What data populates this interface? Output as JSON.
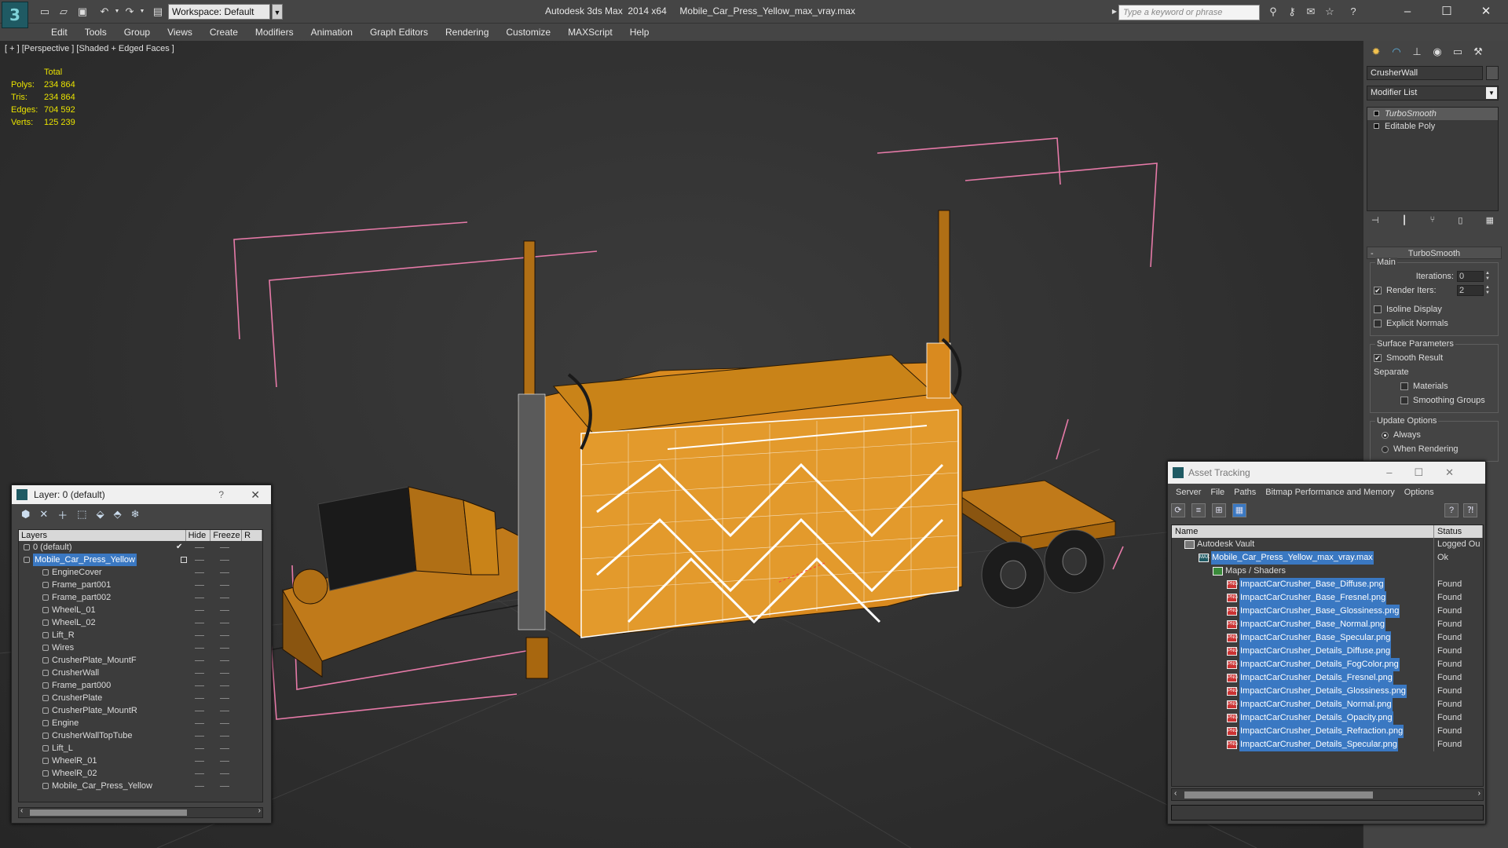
{
  "app": {
    "title": "Autodesk 3ds Max  2014 x64     Mobile_Car_Press_Yellow_max_vray.max",
    "workspace": "Workspace: Default",
    "search_placeholder": "Type a keyword or phrase"
  },
  "menu": [
    "Edit",
    "Tools",
    "Group",
    "Views",
    "Create",
    "Modifiers",
    "Animation",
    "Graph Editors",
    "Rendering",
    "Customize",
    "MAXScript",
    "Help"
  ],
  "viewport": {
    "label": "[ + ] [Perspective ] [Shaded + Edged Faces ]",
    "stats": {
      "header": "Total",
      "rows": [
        {
          "k": "Polys:",
          "v": "234 864"
        },
        {
          "k": "Tris:",
          "v": "234 864"
        },
        {
          "k": "Edges:",
          "v": "704 592"
        },
        {
          "k": "Verts:",
          "v": "125 239"
        }
      ]
    }
  },
  "command_panel": {
    "object_name": "CrusherWall",
    "modifier_list": "Modifier List",
    "stack": [
      "TurboSmooth",
      "Editable Poly"
    ],
    "rollout_title": "TurboSmooth",
    "main_group": "Main",
    "iterations_label": "Iterations:",
    "iterations_value": "0",
    "render_iters_label": "Render Iters:",
    "render_iters_value": "2",
    "isoline": "Isoline Display",
    "explicit": "Explicit Normals",
    "surface_group": "Surface Parameters",
    "smooth_result": "Smooth Result",
    "separate": "Separate",
    "materials": "Materials",
    "smoothing_groups": "Smoothing Groups",
    "update_group": "Update Options",
    "always": "Always",
    "when_rendering": "When Rendering"
  },
  "layer_manager": {
    "title": "Layer: 0 (default)",
    "help": "?",
    "columns": [
      "Layers",
      "Hide",
      "Freeze",
      "R"
    ],
    "layers": [
      {
        "name": "0 (default)",
        "level": 0,
        "selected": false
      },
      {
        "name": "Mobile_Car_Press_Yellow",
        "level": 0,
        "selected": true
      },
      {
        "name": "EngineCover",
        "level": 1
      },
      {
        "name": "Frame_part001",
        "level": 1
      },
      {
        "name": "Frame_part002",
        "level": 1
      },
      {
        "name": "WheelL_01",
        "level": 1
      },
      {
        "name": "WheelL_02",
        "level": 1
      },
      {
        "name": "Lift_R",
        "level": 1
      },
      {
        "name": "Wires",
        "level": 1
      },
      {
        "name": "CrusherPlate_MountF",
        "level": 1
      },
      {
        "name": "CrusherWall",
        "level": 1
      },
      {
        "name": "Frame_part000",
        "level": 1
      },
      {
        "name": "CrusherPlate",
        "level": 1
      },
      {
        "name": "CrusherPlate_MountR",
        "level": 1
      },
      {
        "name": "Engine",
        "level": 1
      },
      {
        "name": "CrusherWallTopTube",
        "level": 1
      },
      {
        "name": "Lift_L",
        "level": 1
      },
      {
        "name": "WheelR_01",
        "level": 1
      },
      {
        "name": "WheelR_02",
        "level": 1
      },
      {
        "name": "Mobile_Car_Press_Yellow",
        "level": 1
      }
    ]
  },
  "asset_tracking": {
    "title": "Asset Tracking",
    "menu": [
      "Server",
      "File",
      "Paths",
      "Bitmap Performance and Memory",
      "Options"
    ],
    "columns": [
      "Name",
      "Status"
    ],
    "rows": [
      {
        "name": "Autodesk Vault",
        "status": "Logged Ou",
        "level": 0,
        "icon": "vault"
      },
      {
        "name": "Mobile_Car_Press_Yellow_max_vray.max",
        "status": "Ok",
        "level": 1,
        "icon": "max",
        "highlight": true
      },
      {
        "name": "Maps / Shaders",
        "status": "",
        "level": 2,
        "icon": "maps"
      },
      {
        "name": "ImpactCarCrusher_Base_Diffuse.png",
        "status": "Found",
        "level": 3,
        "icon": "png",
        "highlight": true
      },
      {
        "name": "ImpactCarCrusher_Base_Fresnel.png",
        "status": "Found",
        "level": 3,
        "icon": "png",
        "highlight": true
      },
      {
        "name": "ImpactCarCrusher_Base_Glossiness.png",
        "status": "Found",
        "level": 3,
        "icon": "png",
        "highlight": true
      },
      {
        "name": "ImpactCarCrusher_Base_Normal.png",
        "status": "Found",
        "level": 3,
        "icon": "png",
        "highlight": true
      },
      {
        "name": "ImpactCarCrusher_Base_Specular.png",
        "status": "Found",
        "level": 3,
        "icon": "png",
        "highlight": true
      },
      {
        "name": "ImpactCarCrusher_Details_Diffuse.png",
        "status": "Found",
        "level": 3,
        "icon": "png",
        "highlight": true
      },
      {
        "name": "ImpactCarCrusher_Details_FogColor.png",
        "status": "Found",
        "level": 3,
        "icon": "png",
        "highlight": true
      },
      {
        "name": "ImpactCarCrusher_Details_Fresnel.png",
        "status": "Found",
        "level": 3,
        "icon": "png",
        "highlight": true
      },
      {
        "name": "ImpactCarCrusher_Details_Glossiness.png",
        "status": "Found",
        "level": 3,
        "icon": "png",
        "highlight": true
      },
      {
        "name": "ImpactCarCrusher_Details_Normal.png",
        "status": "Found",
        "level": 3,
        "icon": "png",
        "highlight": true
      },
      {
        "name": "ImpactCarCrusher_Details_Opacity.png",
        "status": "Found",
        "level": 3,
        "icon": "png",
        "highlight": true
      },
      {
        "name": "ImpactCarCrusher_Details_Refraction.png",
        "status": "Found",
        "level": 3,
        "icon": "png",
        "highlight": true
      },
      {
        "name": "ImpactCarCrusher_Details_Specular.png",
        "status": "Found",
        "level": 3,
        "icon": "png",
        "highlight": true
      }
    ]
  },
  "colors": {
    "model_orange": "#d98a1f",
    "wire_white": "#ffffff",
    "bbox_pink": "#e67aa8",
    "stats_yellow": "#e9e200",
    "selection_blue": "#3a78c2"
  }
}
